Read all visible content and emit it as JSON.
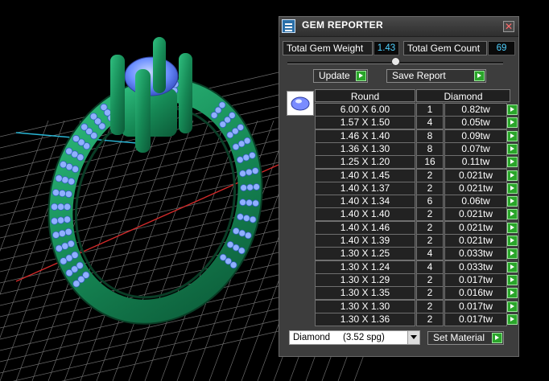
{
  "panel": {
    "title": "GEM REPORTER",
    "close_glyph": "✕",
    "total_gem_weight_label": "Total Gem Weight",
    "total_gem_weight_value": "1.43",
    "total_gem_count_label": "Total Gem Count",
    "total_gem_count_value": "69",
    "slider_level": 0.5,
    "update_label": "Update",
    "save_report_label": "Save Report",
    "table": {
      "thumbnail_icon": "round-diamond-icon",
      "headers": [
        "Round",
        "Diamond"
      ],
      "rows": [
        {
          "size": "6.00 X 6.00",
          "count": "1",
          "weight": "0.82tw"
        },
        {
          "size": "1.57 X 1.50",
          "count": "4",
          "weight": "0.05tw"
        },
        {
          "size": "1.46 X 1.40",
          "count": "8",
          "weight": "0.09tw"
        },
        {
          "size": "1.36 X 1.30",
          "count": "8",
          "weight": "0.07tw"
        },
        {
          "size": "1.25 X 1.20",
          "count": "16",
          "weight": "0.11tw"
        },
        {
          "size": "1.40 X 1.45",
          "count": "2",
          "weight": "0.021tw"
        },
        {
          "size": "1.40 X 1.37",
          "count": "2",
          "weight": "0.021tw"
        },
        {
          "size": "1.40 X 1.34",
          "count": "6",
          "weight": "0.06tw"
        },
        {
          "size": "1.40 X 1.40",
          "count": "2",
          "weight": "0.021tw"
        },
        {
          "size": "1.40 X 1.46",
          "count": "2",
          "weight": "0.021tw"
        },
        {
          "size": "1.40 X 1.39",
          "count": "2",
          "weight": "0.021tw"
        },
        {
          "size": "1.30 X 1.25",
          "count": "4",
          "weight": "0.033tw"
        },
        {
          "size": "1.30 X 1.24",
          "count": "4",
          "weight": "0.033tw"
        },
        {
          "size": "1.30 X 1.29",
          "count": "2",
          "weight": "0.017tw"
        },
        {
          "size": "1.30 X 1.35",
          "count": "2",
          "weight": "0.016tw"
        },
        {
          "size": "1.30 X 1.30",
          "count": "2",
          "weight": "0.017tw"
        },
        {
          "size": "1.30 X 1.36",
          "count": "2",
          "weight": "0.017tw"
        }
      ]
    },
    "material_select_value": "Diamond     (3.52 spg)",
    "set_material_label": "Set Material"
  },
  "colors": {
    "ring_green": "#1f8a5a",
    "gem_blue": "#7aa6ff",
    "value_cyan": "#4fd1ff",
    "button_green": "#2aa52a"
  }
}
